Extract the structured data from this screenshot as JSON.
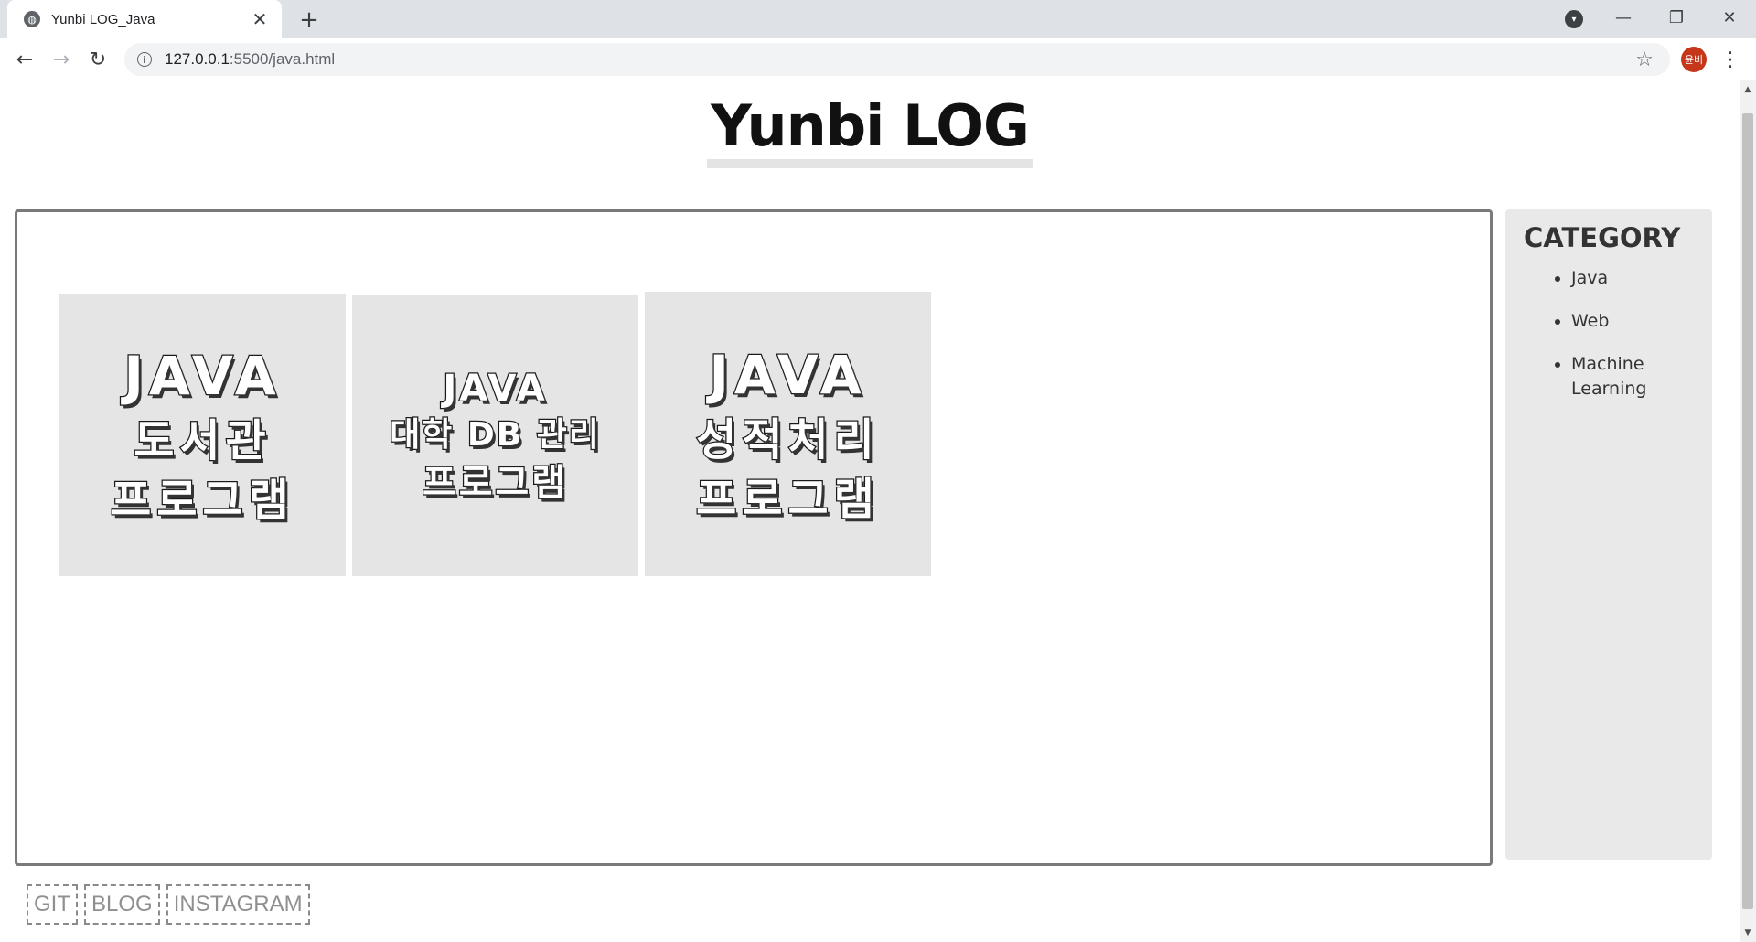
{
  "browser": {
    "tab_title": "Yunbi LOG_Java",
    "url_host": "127.0.0.1",
    "url_path": ":5500/java.html",
    "profile_label": "윤비",
    "icons": {
      "favicon": "globe-icon",
      "tab_close": "close-icon",
      "new_tab": "plus-icon",
      "tab_search": "chevron-down-icon",
      "back": "arrow-left-icon",
      "forward": "arrow-right-icon",
      "reload": "reload-icon",
      "site_info": "info-icon",
      "bookmark": "star-icon",
      "menu": "kebab-menu-icon",
      "minimize": "minimize-icon",
      "maximize": "restore-icon",
      "close_window": "close-icon"
    }
  },
  "page": {
    "title": "Yunbi LOG",
    "posts": [
      {
        "lines": [
          "JAVA",
          "도서관",
          "프로그램"
        ]
      },
      {
        "lines": [
          "JAVA",
          "대학 DB 관리",
          "프로그램"
        ]
      },
      {
        "lines": [
          "JAVA",
          "성적처리",
          "프로그램"
        ]
      }
    ],
    "sidebar": {
      "heading": "CATEGORY",
      "items": [
        "Java",
        "Web",
        "Machine Learning"
      ]
    },
    "footer_links": [
      "GIT",
      "BLOG",
      "INSTAGRAM"
    ]
  },
  "colors": {
    "tabstrip_bg": "#dee1e6",
    "card_bg": "#e5e5e5",
    "sidebar_bg": "#e9e9ea",
    "border": "#7a7a7a",
    "profile_bg": "#c5361b"
  }
}
